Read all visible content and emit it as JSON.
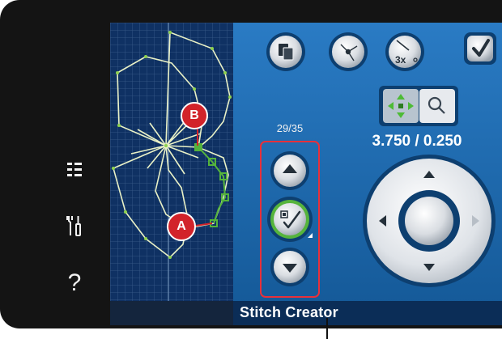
{
  "sidebar": {
    "icons": [
      {
        "name": "menu-list-icon",
        "glyph": "☷"
      },
      {
        "name": "settings-tools-icon",
        "glyph": "tools"
      },
      {
        "name": "help-icon",
        "glyph": "?"
      }
    ]
  },
  "toolbar": {
    "buttons": [
      {
        "name": "duplicate-button",
        "icon": "duplicate-icon"
      },
      {
        "name": "insert-stitch-button",
        "icon": "insert-point-icon"
      },
      {
        "name": "triple-stitch-button",
        "icon": "triple-stitch-icon",
        "text": "3x"
      },
      {
        "name": "confirm-button",
        "icon": "checkmark-icon"
      }
    ]
  },
  "stitch_counter": "29/35",
  "markers": {
    "a": "A",
    "b": "B"
  },
  "mode_toggle": {
    "pan_icon": "move-arrows-icon",
    "zoom_icon": "magnifier-icon",
    "selected": "pan"
  },
  "coordinates": "3.750 / 0.250",
  "step_controls": {
    "up_icon": "step-up-icon",
    "select_icon": "select-stitch-icon",
    "down_icon": "step-down-icon"
  },
  "wheel": {
    "icon": "navigation-wheel-icon"
  },
  "footer": {
    "title": "Stitch Creator"
  },
  "colors": {
    "canvas": "#0f3163",
    "panel": "#1f6bb2",
    "accent_green": "#55b43c",
    "marker_red": "#d2232a",
    "highlight_red": "#e8303a"
  }
}
